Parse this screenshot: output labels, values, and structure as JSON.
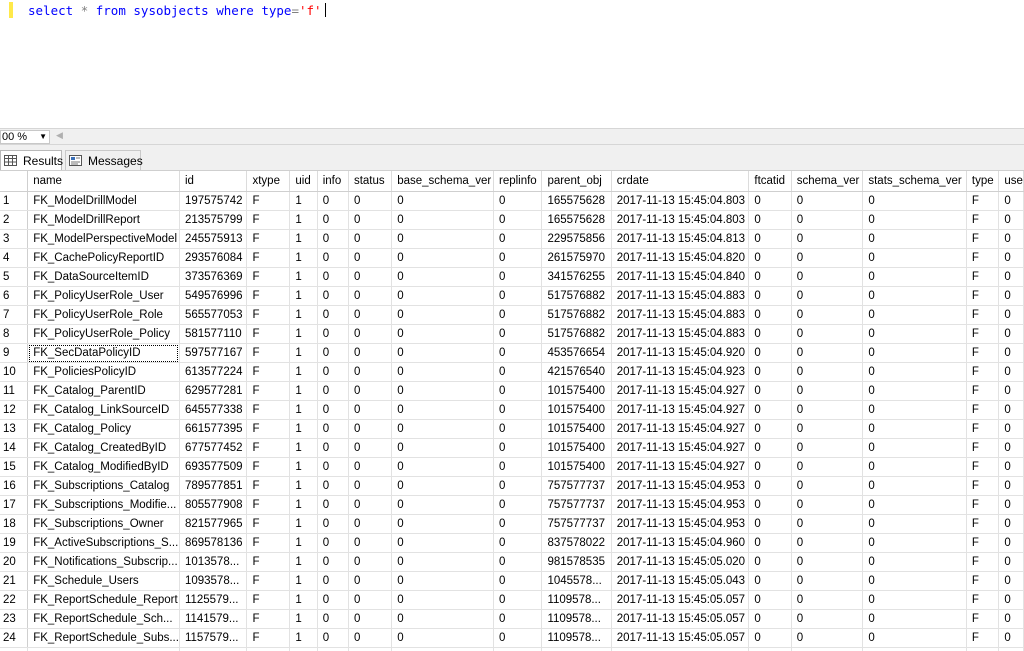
{
  "editor": {
    "query": {
      "kw_select": "select",
      "star": "*",
      "kw_from": "from",
      "table": "sysobjects",
      "kw_where": "where",
      "col": "type",
      "eq": "=",
      "val": "'f'"
    }
  },
  "zoom": {
    "value": "00 %"
  },
  "tabs": {
    "results": "Results",
    "messages": "Messages"
  },
  "grid": {
    "columns": [
      "name",
      "id",
      "xtype",
      "uid",
      "info",
      "status",
      "base_schema_ver",
      "replinfo",
      "parent_obj",
      "crdate",
      "ftcatid",
      "schema_ver",
      "stats_schema_ver",
      "type",
      "use"
    ],
    "rows": [
      [
        "1",
        "FK_ModelDrillModel",
        "197575742",
        "F",
        "1",
        "0",
        "0",
        "0",
        "0",
        "165575628",
        "2017-11-13 15:45:04.803",
        "0",
        "0",
        "0",
        "F",
        "0"
      ],
      [
        "2",
        "FK_ModelDrillReport",
        "213575799",
        "F",
        "1",
        "0",
        "0",
        "0",
        "0",
        "165575628",
        "2017-11-13 15:45:04.803",
        "0",
        "0",
        "0",
        "F",
        "0"
      ],
      [
        "3",
        "FK_ModelPerspectiveModel",
        "245575913",
        "F",
        "1",
        "0",
        "0",
        "0",
        "0",
        "229575856",
        "2017-11-13 15:45:04.813",
        "0",
        "0",
        "0",
        "F",
        "0"
      ],
      [
        "4",
        "FK_CachePolicyReportID",
        "293576084",
        "F",
        "1",
        "0",
        "0",
        "0",
        "0",
        "261575970",
        "2017-11-13 15:45:04.820",
        "0",
        "0",
        "0",
        "F",
        "0"
      ],
      [
        "5",
        "FK_DataSourceItemID",
        "373576369",
        "F",
        "1",
        "0",
        "0",
        "0",
        "0",
        "341576255",
        "2017-11-13 15:45:04.840",
        "0",
        "0",
        "0",
        "F",
        "0"
      ],
      [
        "6",
        "FK_PolicyUserRole_User",
        "549576996",
        "F",
        "1",
        "0",
        "0",
        "0",
        "0",
        "517576882",
        "2017-11-13 15:45:04.883",
        "0",
        "0",
        "0",
        "F",
        "0"
      ],
      [
        "7",
        "FK_PolicyUserRole_Role",
        "565577053",
        "F",
        "1",
        "0",
        "0",
        "0",
        "0",
        "517576882",
        "2017-11-13 15:45:04.883",
        "0",
        "0",
        "0",
        "F",
        "0"
      ],
      [
        "8",
        "FK_PolicyUserRole_Policy",
        "581577110",
        "F",
        "1",
        "0",
        "0",
        "0",
        "0",
        "517576882",
        "2017-11-13 15:45:04.883",
        "0",
        "0",
        "0",
        "F",
        "0"
      ],
      [
        "9",
        "FK_SecDataPolicyID",
        "597577167",
        "F",
        "1",
        "0",
        "0",
        "0",
        "0",
        "453576654",
        "2017-11-13 15:45:04.920",
        "0",
        "0",
        "0",
        "F",
        "0"
      ],
      [
        "10",
        "FK_PoliciesPolicyID",
        "613577224",
        "F",
        "1",
        "0",
        "0",
        "0",
        "0",
        "421576540",
        "2017-11-13 15:45:04.923",
        "0",
        "0",
        "0",
        "F",
        "0"
      ],
      [
        "11",
        "FK_Catalog_ParentID",
        "629577281",
        "F",
        "1",
        "0",
        "0",
        "0",
        "0",
        "101575400",
        "2017-11-13 15:45:04.927",
        "0",
        "0",
        "0",
        "F",
        "0"
      ],
      [
        "12",
        "FK_Catalog_LinkSourceID",
        "645577338",
        "F",
        "1",
        "0",
        "0",
        "0",
        "0",
        "101575400",
        "2017-11-13 15:45:04.927",
        "0",
        "0",
        "0",
        "F",
        "0"
      ],
      [
        "13",
        "FK_Catalog_Policy",
        "661577395",
        "F",
        "1",
        "0",
        "0",
        "0",
        "0",
        "101575400",
        "2017-11-13 15:45:04.927",
        "0",
        "0",
        "0",
        "F",
        "0"
      ],
      [
        "14",
        "FK_Catalog_CreatedByID",
        "677577452",
        "F",
        "1",
        "0",
        "0",
        "0",
        "0",
        "101575400",
        "2017-11-13 15:45:04.927",
        "0",
        "0",
        "0",
        "F",
        "0"
      ],
      [
        "15",
        "FK_Catalog_ModifiedByID",
        "693577509",
        "F",
        "1",
        "0",
        "0",
        "0",
        "0",
        "101575400",
        "2017-11-13 15:45:04.927",
        "0",
        "0",
        "0",
        "F",
        "0"
      ],
      [
        "16",
        "FK_Subscriptions_Catalog",
        "789577851",
        "F",
        "1",
        "0",
        "0",
        "0",
        "0",
        "757577737",
        "2017-11-13 15:45:04.953",
        "0",
        "0",
        "0",
        "F",
        "0"
      ],
      [
        "17",
        "FK_Subscriptions_Modifie...",
        "805577908",
        "F",
        "1",
        "0",
        "0",
        "0",
        "0",
        "757577737",
        "2017-11-13 15:45:04.953",
        "0",
        "0",
        "0",
        "F",
        "0"
      ],
      [
        "18",
        "FK_Subscriptions_Owner",
        "821577965",
        "F",
        "1",
        "0",
        "0",
        "0",
        "0",
        "757577737",
        "2017-11-13 15:45:04.953",
        "0",
        "0",
        "0",
        "F",
        "0"
      ],
      [
        "19",
        "FK_ActiveSubscriptions_S...",
        "869578136",
        "F",
        "1",
        "0",
        "0",
        "0",
        "0",
        "837578022",
        "2017-11-13 15:45:04.960",
        "0",
        "0",
        "0",
        "F",
        "0"
      ],
      [
        "20",
        "FK_Notifications_Subscrip...",
        "1013578...",
        "F",
        "1",
        "0",
        "0",
        "0",
        "0",
        "981578535",
        "2017-11-13 15:45:05.020",
        "0",
        "0",
        "0",
        "F",
        "0"
      ],
      [
        "21",
        "FK_Schedule_Users",
        "1093578...",
        "F",
        "1",
        "0",
        "0",
        "0",
        "0",
        "1045578...",
        "2017-11-13 15:45:05.043",
        "0",
        "0",
        "0",
        "F",
        "0"
      ],
      [
        "22",
        "FK_ReportSchedule_Report",
        "1125579...",
        "F",
        "1",
        "0",
        "0",
        "0",
        "0",
        "1109578...",
        "2017-11-13 15:45:05.057",
        "0",
        "0",
        "0",
        "F",
        "0"
      ],
      [
        "23",
        "FK_ReportSchedule_Sch...",
        "1141579...",
        "F",
        "1",
        "0",
        "0",
        "0",
        "0",
        "1109578...",
        "2017-11-13 15:45:05.057",
        "0",
        "0",
        "0",
        "F",
        "0"
      ],
      [
        "24",
        "FK_ReportSchedule_Subs...",
        "1157579...",
        "F",
        "1",
        "0",
        "0",
        "0",
        "0",
        "1109578...",
        "2017-11-13 15:45:05.057",
        "0",
        "0",
        "0",
        "F",
        "0"
      ]
    ],
    "selected_row": 8
  }
}
